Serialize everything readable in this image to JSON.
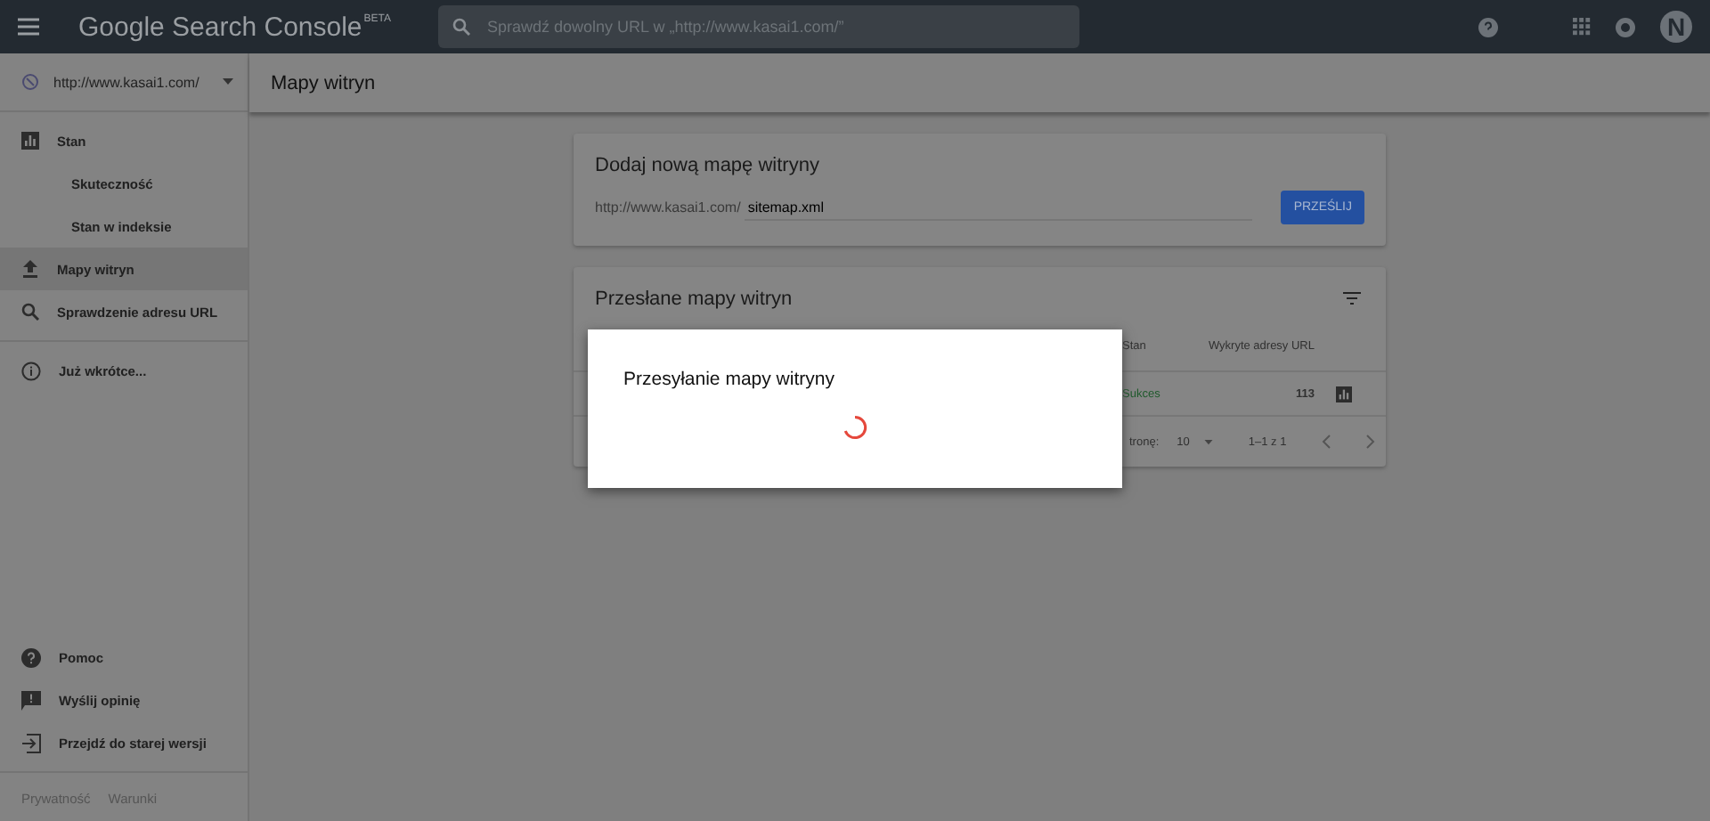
{
  "header": {
    "logo": "Google Search Console",
    "logo_badge": "BETA",
    "search": {
      "placeholder": "Sprawdź dowolny URL w „http://www.kasai1.com/”"
    },
    "avatar_letter": "N"
  },
  "sidebar": {
    "property": "http://www.kasai1.com/",
    "items": [
      {
        "label": "Stan",
        "kind": "chart",
        "selected": false,
        "children": [
          {
            "label": "Skuteczność",
            "selected": false
          },
          {
            "label": "Stan w indeksie",
            "selected": false
          }
        ]
      },
      {
        "label": "Mapy witryn",
        "kind": "upload",
        "selected": true
      },
      {
        "label": "Sprawdzenie adresu URL",
        "kind": "search",
        "selected": false
      },
      {
        "label": "Już wkrótce...",
        "kind": "info",
        "selected": false
      }
    ],
    "bottom_items": [
      {
        "label": "Pomoc",
        "kind": "help"
      },
      {
        "label": "Wyślij opinię",
        "kind": "feedback"
      },
      {
        "label": "Przejdź do starej wersji",
        "kind": "exit"
      }
    ],
    "footer_links": [
      "Prywatność",
      "Warunki"
    ]
  },
  "page_title": "Mapy witryn",
  "add_card": {
    "title": "Dodaj nową mapę witryny",
    "prefix": "http://www.kasai1.com/",
    "value": "sitemap.xml",
    "button": "PRZEŚLIJ"
  },
  "list_card": {
    "title": "Przesłane mapy witryn",
    "columns": [
      "Stan",
      "Wykryte adresy URL"
    ],
    "rows": [
      {
        "status": "Sukces",
        "urls": "113"
      }
    ],
    "pagination": {
      "rows_label": "tronę:",
      "rows_value": "10",
      "range": "1–1 z 1"
    }
  },
  "dialog": {
    "title": "Przesyłanie mapy witryny",
    "loading": true
  }
}
